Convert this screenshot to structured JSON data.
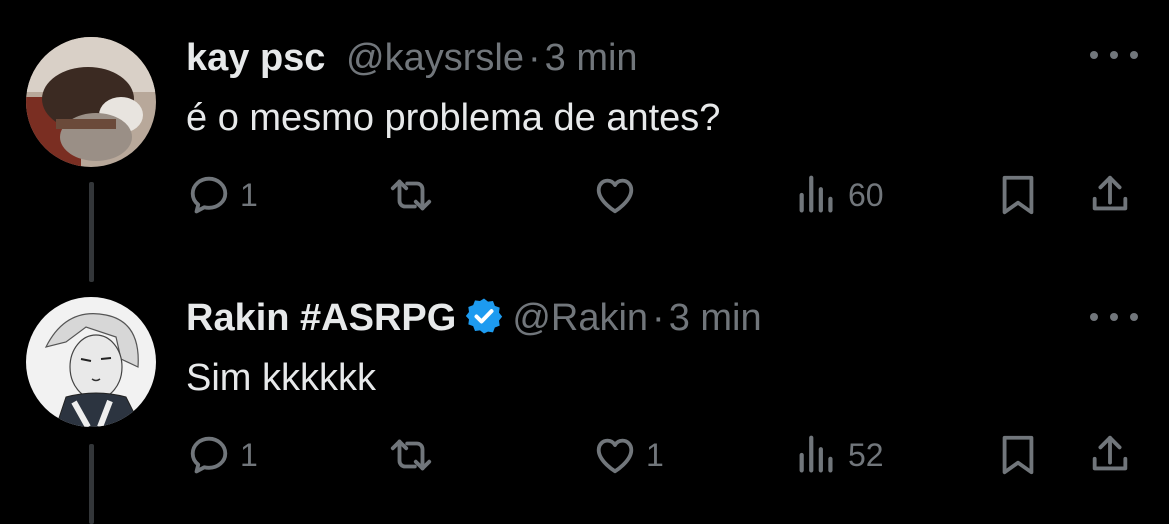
{
  "colors": {
    "background": "#000000",
    "text": "#e7e9ea",
    "muted": "#71767b",
    "verified": "#1d9bf0",
    "line": "#333639"
  },
  "tweets": [
    {
      "name": "kay psc",
      "handle": "@kaysrsle",
      "separator": "·",
      "time": "3 min",
      "verified": false,
      "text": "é o mesmo problema de antes?",
      "replies": "1",
      "retweets": "",
      "likes": "",
      "views": "60",
      "icons": {
        "reply": "reply-icon",
        "retweet": "retweet-icon",
        "like": "heart-icon",
        "views": "views-icon",
        "bookmark": "bookmark-icon",
        "share": "share-icon",
        "more": "more-icon"
      }
    },
    {
      "name": "Rakin #ASRPG",
      "handle": "@Rakin",
      "separator": "·",
      "time": "3 min",
      "verified": true,
      "text": "Sim kkkkkk",
      "replies": "1",
      "retweets": "",
      "likes": "1",
      "views": "52",
      "icons": {
        "reply": "reply-icon",
        "retweet": "retweet-icon",
        "like": "heart-icon",
        "views": "views-icon",
        "bookmark": "bookmark-icon",
        "share": "share-icon",
        "more": "more-icon"
      }
    }
  ]
}
